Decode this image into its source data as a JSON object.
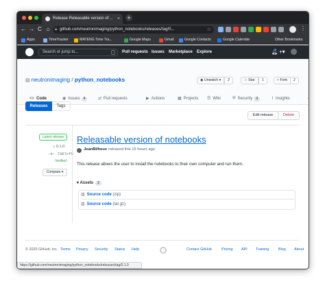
{
  "browser": {
    "tab_title": "Release Releasable version of ...",
    "tab_close": "×",
    "new_tab": "+",
    "url": "github.com/neutronimaging/python_notebooks/releases/tag/0...",
    "nav": {
      "back": "←",
      "forward": "→",
      "reload": "C",
      "home": "⌂"
    },
    "menu": "⋮",
    "bookmarks": [
      {
        "label": "Apps",
        "color": "#4285f4"
      },
      {
        "label": "TimeTracker",
        "color": "#8ab4f8"
      },
      {
        "label": "MATENG Time Tra...",
        "color": "#fbbc04"
      },
      {
        "label": "Google Maps",
        "color": "#34a853"
      },
      {
        "label": "Gmail",
        "color": "#ea4335"
      },
      {
        "label": "Google Contacts",
        "color": "#4285f4"
      },
      {
        "label": "Google Calendar",
        "color": "#1a73e8"
      }
    ],
    "other_bookmarks": "Other Bookmarks"
  },
  "github": {
    "search_placeholder": "Search or jump to...",
    "search_key": "/",
    "nav": [
      "Pull requests",
      "Issues",
      "Marketplace",
      "Explore"
    ]
  },
  "repo": {
    "owner": "neutronimaging",
    "separator": "/",
    "name": "python_notebooks",
    "unwatch": "Unwatch ▾",
    "unwatch_count": "2",
    "star": "Star",
    "star_count": "1",
    "fork": "Fork",
    "fork_count": "2",
    "tabs": [
      {
        "label": "Code",
        "icon": "<>",
        "count": ""
      },
      {
        "label": "Issues",
        "icon": "◉",
        "count": "4"
      },
      {
        "label": "Pull requests",
        "icon": "⇄",
        "count": ""
      },
      {
        "label": "Actions",
        "icon": "▶",
        "count": ""
      },
      {
        "label": "Projects",
        "icon": "▦",
        "count": ""
      },
      {
        "label": "Wiki",
        "icon": "☰",
        "count": ""
      },
      {
        "label": "Security",
        "icon": "⛨",
        "count": "9"
      },
      {
        "label": "Insights",
        "icon": "⌇",
        "count": ""
      }
    ],
    "more": "···"
  },
  "release_nav": {
    "releases": "Releases",
    "tags": "Tags",
    "edit": "Edit release",
    "delete": "Delete"
  },
  "release": {
    "latest_badge": "Latest release",
    "tag": "0.1.0",
    "commit": "7367cf5",
    "verified": "Verified",
    "compare": "Compare ▾",
    "title": "Releasable version of notebooks",
    "author": "JeanBilheux",
    "released": "released this 15 hours ago",
    "description": "This release allows the user to install the notebooks to their own computer and run them.",
    "assets_label": "Assets",
    "assets_count": "2",
    "assets": [
      {
        "label": "Source code",
        "ext": "(zip)"
      },
      {
        "label": "Source code",
        "ext": "(tar.gz)"
      }
    ]
  },
  "footer": {
    "copyright": "© 2020 GitHub, Inc.",
    "left_links": [
      "Terms",
      "Privacy",
      "Security",
      "Status",
      "Help"
    ],
    "right_links": [
      "Contact GitHub",
      "Pricing",
      "API",
      "Training",
      "Blog",
      "About"
    ]
  },
  "status_url": "https://github.com/neutronimaging/python_notebooks/releases/tag/0.1.0"
}
